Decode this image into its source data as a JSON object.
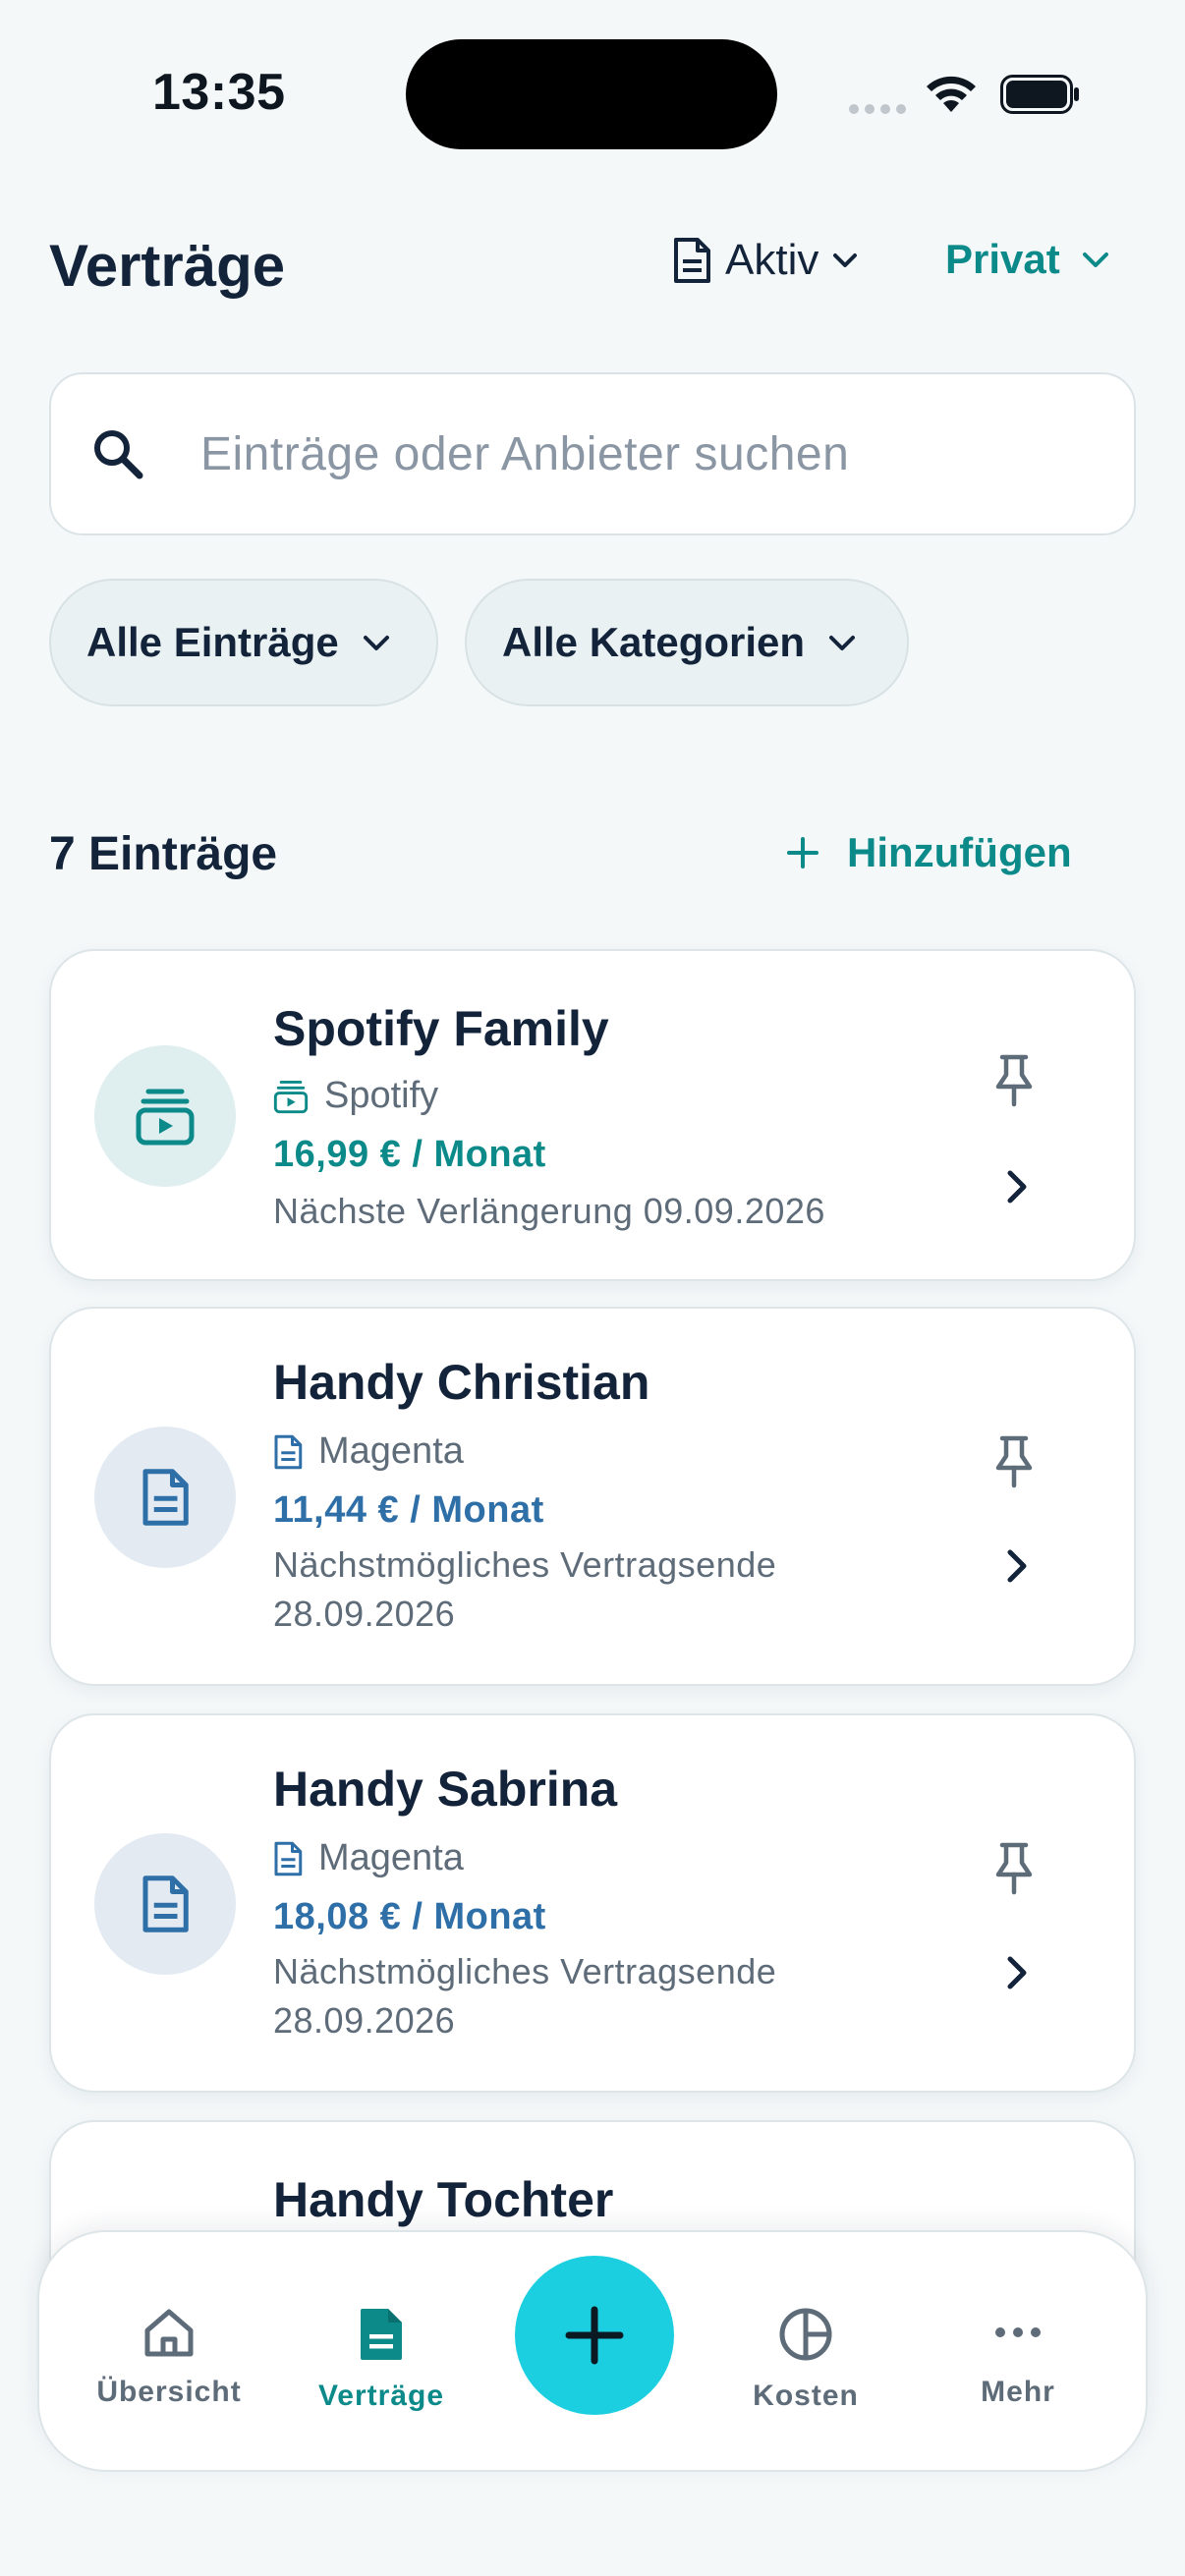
{
  "status_bar": {
    "time": "13:35"
  },
  "header": {
    "title": "Verträge",
    "status_filter": "Aktiv",
    "profile": "Privat"
  },
  "search": {
    "placeholder": "Einträge oder Anbieter suchen"
  },
  "chips": {
    "entries": "Alle Einträge",
    "categories": "Alle Kategorien"
  },
  "list": {
    "count": "7 Einträge",
    "add_label": "Hinzufügen",
    "items": [
      {
        "title": "Spotify Family",
        "provider": "Spotify",
        "price": "16,99 € / Monat",
        "detail": "Nächste Verlängerung 09.09.2026",
        "icon": "subscription-icon"
      },
      {
        "title": "Handy Christian",
        "provider": "Magenta",
        "price": "11,44 € / Monat",
        "detail": "Nächstmögliches Vertragsende 28.09.2026",
        "icon": "document-icon"
      },
      {
        "title": "Handy Sabrina",
        "provider": "Magenta",
        "price": "18,08 € / Monat",
        "detail": "Nächstmögliches Vertragsende 28.09.2026",
        "icon": "document-icon"
      },
      {
        "title": "Handy Tochter"
      }
    ]
  },
  "nav": {
    "overview": "Übersicht",
    "contracts": "Verträge",
    "costs": "Kosten",
    "more": "Mehr"
  },
  "colors": {
    "accent": "#0c8a8a",
    "price_blue": "#2f6fa8",
    "fab": "#1ccfe0",
    "background": "#f4f8f9"
  }
}
